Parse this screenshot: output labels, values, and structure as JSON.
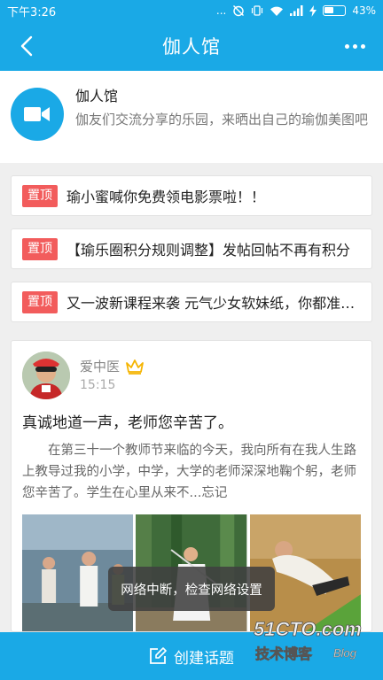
{
  "status_bar": {
    "time": "下午3:26",
    "signal_dots": "...",
    "battery": "43%"
  },
  "app_bar": {
    "title": "伽人馆",
    "back_icon": "chevron-left-icon",
    "more_icon": "more-dots-icon"
  },
  "group": {
    "icon": "video-camera-icon",
    "name": "伽人馆",
    "description": "伽友们交流分享的乐园，来晒出自己的瑜伽美图吧"
  },
  "pinned": [
    {
      "tag": "置顶",
      "text": "瑜小蜜喊你免费领电影票啦！！"
    },
    {
      "tag": "置顶",
      "text": "【瑜乐圈积分规则调整】发帖回帖不再有积分"
    },
    {
      "tag": "置顶",
      "text": "又一波新课程来袭 元气少女软妹纸，你都准备好了吗"
    }
  ],
  "post": {
    "author": "爱中医",
    "badge_icon": "crown-icon",
    "time": "15:15",
    "title": "真诚地道一声，老师您辛苦了。",
    "body": "在第三十一个教师节来临的今天，我向所有在我人生路上教导过我的小学，中学，大学的老师深深地鞠个躬，老师您辛苦了。学生在心里从来不...忘记"
  },
  "toast": {
    "text": "网络中断，检查网络设置"
  },
  "bottom_bar": {
    "icon": "edit-icon",
    "label": "创建话题"
  },
  "watermark": {
    "top": "51CTO.com",
    "bottom_left": "技术博客",
    "bottom_right": "Blog"
  },
  "colors": {
    "primary": "#1aa9e6",
    "pin_tag": "#f25c5c",
    "crown": "#f5b400"
  }
}
